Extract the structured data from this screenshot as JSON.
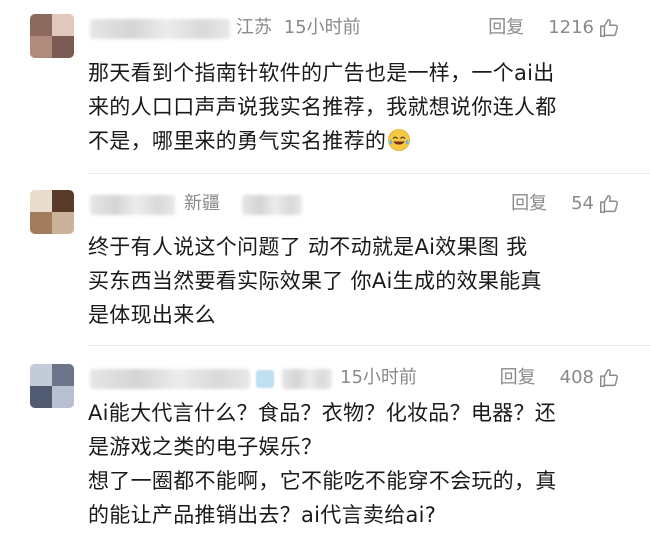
{
  "comments": [
    {
      "location": "江苏",
      "time": "15小时前",
      "reply_label": "回复",
      "likes": "1216",
      "text_lines": [
        "那天看到个指南针软件的广告也是一样，一个ai出",
        "来的人口口声声说我实名推荐，我就想说你连人都",
        "不是，哪里来的勇气实名推荐的"
      ],
      "emoji": "crying-laughing-emoji"
    },
    {
      "location": "新疆",
      "time": "",
      "reply_label": "回复",
      "likes": "54",
      "text_lines": [
        "终于有人说这个问题了  动不动就是Ai效果图  我",
        "买东西当然要看实际效果了  你Ai生成的效果能真",
        "是体现出来么"
      ]
    },
    {
      "location": "",
      "time": "15小时前",
      "reply_label": "回复",
      "likes": "408",
      "text_lines": [
        "Ai能大代言什么？食品？衣物？化妆品？电器？还",
        "是游戏之类的电子娱乐？",
        "想了一圈都不能啊，它不能吃不能穿不会玩的，真",
        "的能让产品推销出去？ai代言卖给ai?"
      ]
    }
  ],
  "icons": {
    "like": "thumbs-up-icon"
  }
}
